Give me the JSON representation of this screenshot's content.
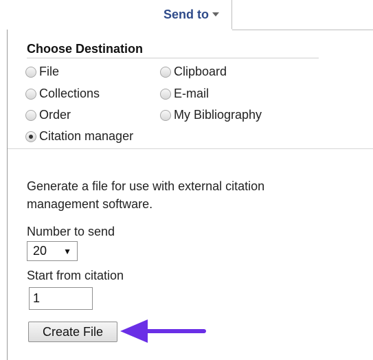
{
  "header": {
    "send_to_label": "Send to"
  },
  "destination": {
    "heading": "Choose Destination",
    "options": [
      {
        "label": "File",
        "checked": false
      },
      {
        "label": "Clipboard",
        "checked": false
      },
      {
        "label": "Collections",
        "checked": false
      },
      {
        "label": "E-mail",
        "checked": false
      },
      {
        "label": "Order",
        "checked": false
      },
      {
        "label": "My Bibliography",
        "checked": false
      },
      {
        "label": "Citation manager",
        "checked": true
      }
    ]
  },
  "citation": {
    "description": "Generate a file for use with external citation management software.",
    "number_label": "Number to send",
    "number_value": "20",
    "start_label": "Start from citation",
    "start_value": "1",
    "create_button": "Create File"
  },
  "colors": {
    "link_blue": "#2f4b8a",
    "annotation_arrow": "#6a2fe6"
  },
  "icons": {
    "send_to_dropdown": "chevron-down-icon",
    "select_dropdown": "triangle-down-icon",
    "annotation": "arrow-left-icon"
  }
}
